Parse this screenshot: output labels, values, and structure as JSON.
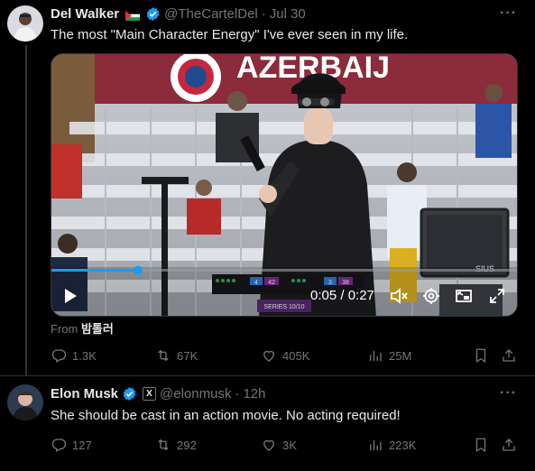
{
  "tweets": [
    {
      "display_name": "Del Walker",
      "handle": "@TheCartelDel",
      "separator": "·",
      "date": "Jul 30",
      "text": "The most \"Main Character Energy\" I've ever seen in my life.",
      "media": {
        "banner_text": "AZERBAIJ",
        "time_display": "0:05 / 0:27",
        "scoreboard": {
          "left_score": "4",
          "left_total": "42",
          "right_score": "3",
          "right_total": "38",
          "series": "SERIES 10/10",
          "brand": "SIUS"
        }
      },
      "from_label": "From",
      "from_user": "밤톨러",
      "stats": {
        "replies": "1.3K",
        "reposts": "67K",
        "likes": "405K",
        "views": "25M"
      }
    },
    {
      "display_name": "Elon Musk",
      "handle": "@elonmusk",
      "affiliation_badge": "X",
      "separator": "·",
      "date": "12h",
      "text": "She should be cast in an action movie. No  acting required!",
      "stats": {
        "replies": "127",
        "reposts": "292",
        "likes": "3K",
        "views": "223K"
      }
    }
  ],
  "icons": {
    "more": "more-horizontal-icon",
    "verified": "verified-badge-icon",
    "reply": "reply-icon",
    "repost": "repost-icon",
    "like": "heart-icon",
    "views": "analytics-icon",
    "bookmark": "bookmark-icon",
    "share": "share-icon",
    "play": "play-icon",
    "mute": "volume-muted-icon",
    "settings": "settings-icon",
    "pip": "picture-in-picture-icon",
    "fullscreen": "fullscreen-icon"
  },
  "colors": {
    "background": "#000000",
    "text": "#e7e9ea",
    "muted": "#71767b",
    "verified_blue": "#1d9bf0",
    "divider": "#2f3336",
    "progress": "#1d9bf0"
  }
}
